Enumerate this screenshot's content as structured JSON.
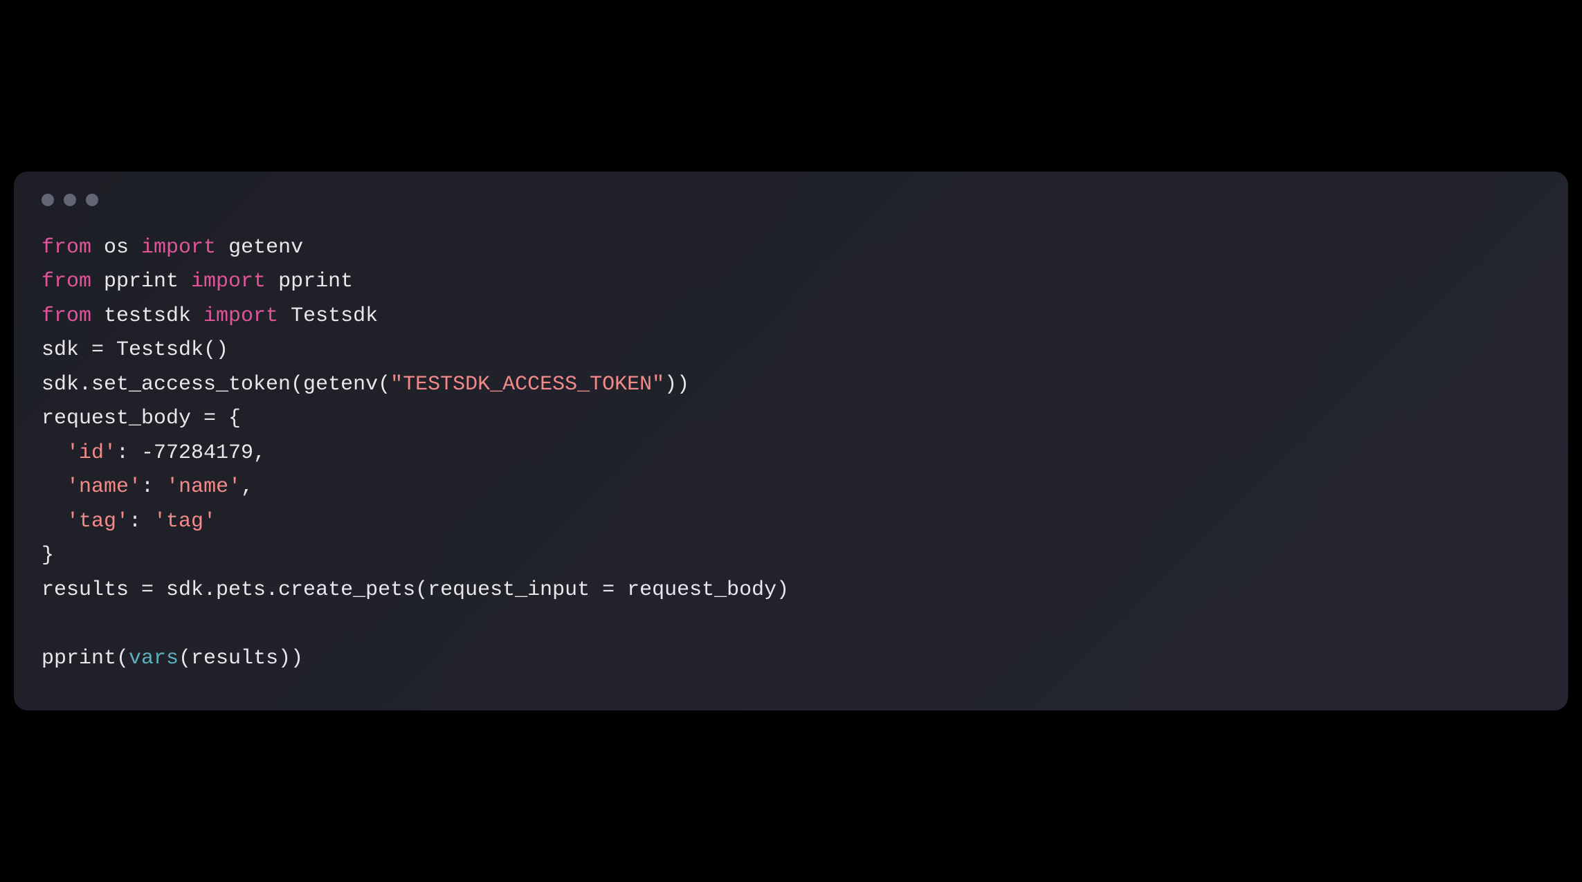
{
  "window": {
    "dots": [
      "dot1",
      "dot2",
      "dot3"
    ]
  },
  "code": {
    "lines": [
      {
        "tokens": [
          {
            "t": "from ",
            "c": "kw-from"
          },
          {
            "t": "os ",
            "c": "ident-default"
          },
          {
            "t": "import ",
            "c": "kw-import"
          },
          {
            "t": "getenv",
            "c": "ident-default"
          }
        ]
      },
      {
        "tokens": [
          {
            "t": "from ",
            "c": "kw-from"
          },
          {
            "t": "pprint ",
            "c": "ident-default"
          },
          {
            "t": "import ",
            "c": "kw-import"
          },
          {
            "t": "pprint",
            "c": "ident-default"
          }
        ]
      },
      {
        "tokens": [
          {
            "t": "from ",
            "c": "kw-from"
          },
          {
            "t": "testsdk ",
            "c": "ident-default"
          },
          {
            "t": "import ",
            "c": "kw-import"
          },
          {
            "t": "Testsdk",
            "c": "ident-default"
          }
        ]
      },
      {
        "tokens": [
          {
            "t": "sdk = Testsdk()",
            "c": "ident-default"
          }
        ]
      },
      {
        "tokens": [
          {
            "t": "sdk.set_access_token(getenv(",
            "c": "ident-default"
          },
          {
            "t": "\"TESTSDK_ACCESS_TOKEN\"",
            "c": "str"
          },
          {
            "t": "))",
            "c": "ident-default"
          }
        ]
      },
      {
        "tokens": [
          {
            "t": "request_body = {",
            "c": "ident-default"
          }
        ]
      },
      {
        "tokens": [
          {
            "t": "  ",
            "c": "ident-default"
          },
          {
            "t": "'id'",
            "c": "str"
          },
          {
            "t": ": -77284179,",
            "c": "ident-default"
          }
        ]
      },
      {
        "tokens": [
          {
            "t": "  ",
            "c": "ident-default"
          },
          {
            "t": "'name'",
            "c": "str"
          },
          {
            "t": ": ",
            "c": "ident-default"
          },
          {
            "t": "'name'",
            "c": "str"
          },
          {
            "t": ",",
            "c": "ident-default"
          }
        ]
      },
      {
        "tokens": [
          {
            "t": "  ",
            "c": "ident-default"
          },
          {
            "t": "'tag'",
            "c": "str"
          },
          {
            "t": ": ",
            "c": "ident-default"
          },
          {
            "t": "'tag'",
            "c": "str"
          }
        ]
      },
      {
        "tokens": [
          {
            "t": "}",
            "c": "ident-default"
          }
        ]
      },
      {
        "tokens": [
          {
            "t": "results = sdk.pets.create_pets(request_input = request_body)",
            "c": "ident-default"
          }
        ]
      },
      {
        "tokens": [
          {
            "t": "",
            "c": "ident-default"
          }
        ]
      },
      {
        "tokens": [
          {
            "t": "pprint(",
            "c": "ident-default"
          },
          {
            "t": "vars",
            "c": "builtin"
          },
          {
            "t": "(results))",
            "c": "ident-default"
          }
        ]
      }
    ]
  }
}
